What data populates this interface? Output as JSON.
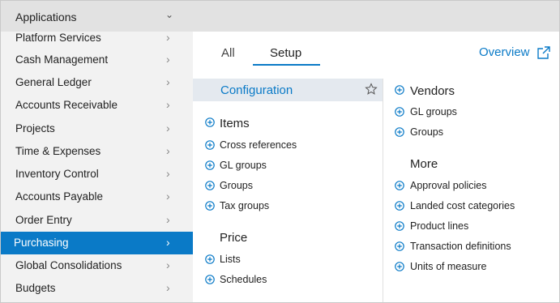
{
  "sidebar": {
    "header": "Applications",
    "items": [
      {
        "label": "Platform Services",
        "active": false
      },
      {
        "label": "Cash Management",
        "active": false
      },
      {
        "label": "General Ledger",
        "active": false
      },
      {
        "label": "Accounts Receivable",
        "active": false
      },
      {
        "label": "Projects",
        "active": false
      },
      {
        "label": "Time & Expenses",
        "active": false
      },
      {
        "label": "Inventory Control",
        "active": false
      },
      {
        "label": "Accounts Payable",
        "active": false
      },
      {
        "label": "Order Entry",
        "active": false
      },
      {
        "label": "Purchasing",
        "active": true
      },
      {
        "label": "Global Consolidations",
        "active": false
      },
      {
        "label": "Budgets",
        "active": false
      }
    ]
  },
  "tabs": [
    {
      "label": "All",
      "selected": false
    },
    {
      "label": "Setup",
      "selected": true
    }
  ],
  "overview": {
    "label": "Overview",
    "icon": "external-link-icon"
  },
  "config": {
    "label": "Configuration",
    "icon": "star-icon"
  },
  "left_col": {
    "groups": [
      {
        "title": "Items",
        "links": [
          "Cross references",
          "GL groups",
          "Groups",
          "Tax groups"
        ]
      },
      {
        "title": "Price",
        "links": [
          "Lists",
          "Schedules"
        ]
      }
    ]
  },
  "right_col": {
    "groups": [
      {
        "title": "Vendors",
        "links": [
          "GL groups",
          "Groups"
        ]
      },
      {
        "title": "More",
        "links": [
          "Approval policies",
          "Landed cost categories",
          "Product lines",
          "Transaction definitions",
          "Units of measure"
        ]
      }
    ]
  },
  "colors": {
    "accent": "#0a7ac7",
    "sidebar_bg": "#f2f2f2",
    "header_bg": "#e2e2e2",
    "config_bg": "#e4e9ef"
  }
}
